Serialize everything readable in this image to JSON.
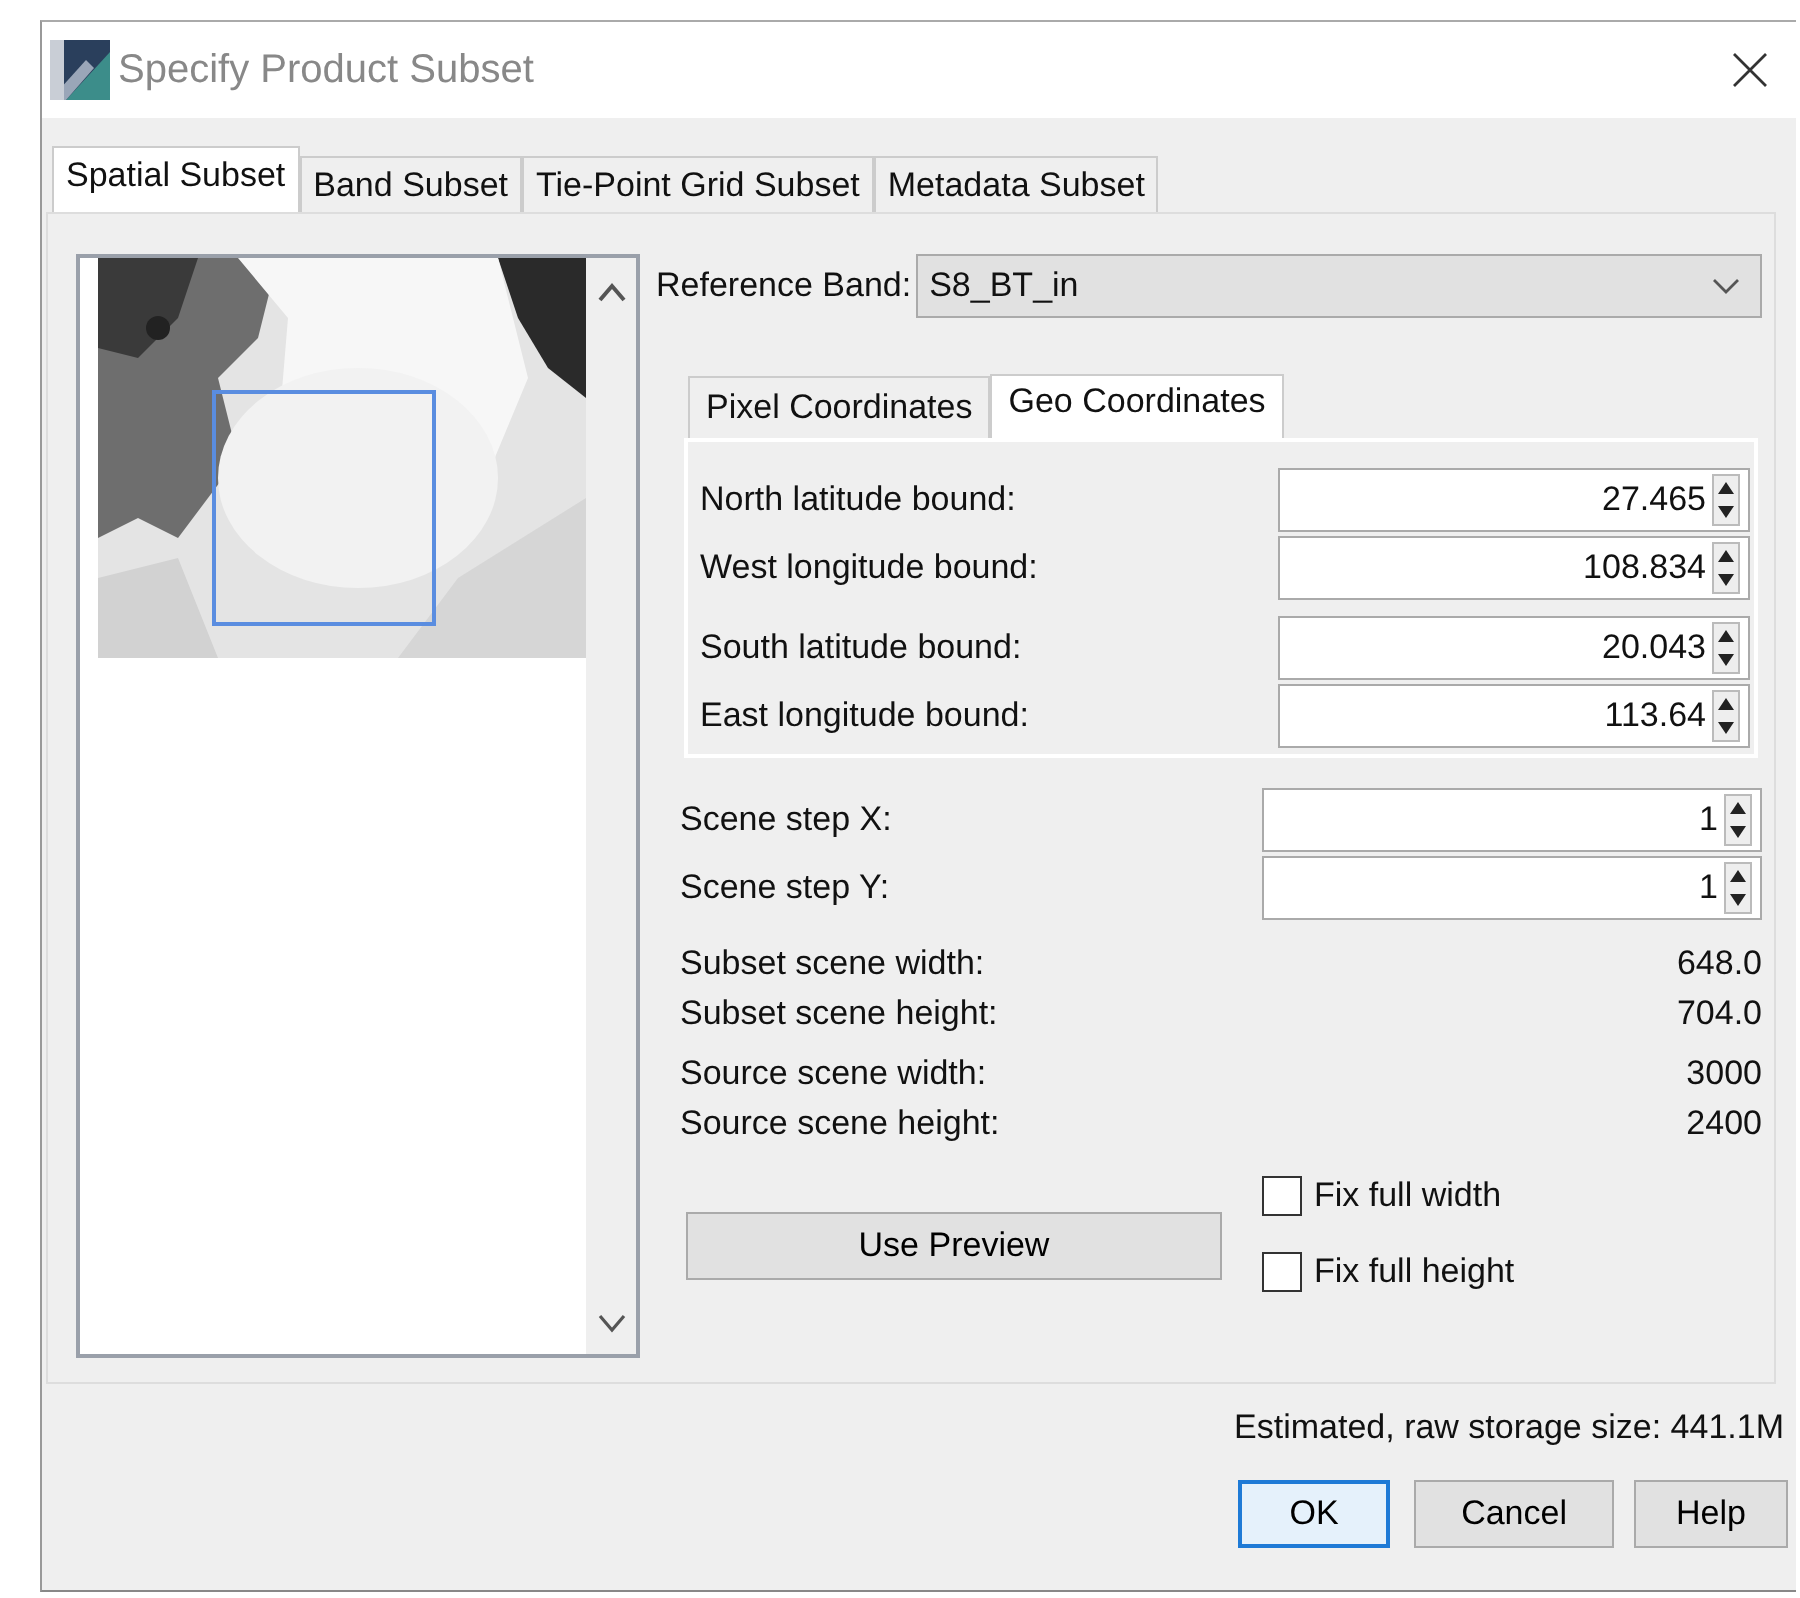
{
  "window": {
    "title": "Specify Product Subset"
  },
  "tabs": [
    {
      "label": "Spatial Subset",
      "selected": true
    },
    {
      "label": "Band Subset",
      "selected": false
    },
    {
      "label": "Tie-Point Grid Subset",
      "selected": false
    },
    {
      "label": "Metadata Subset",
      "selected": false
    }
  ],
  "reference_band": {
    "label": "Reference Band:",
    "value": "S8_BT_in"
  },
  "coordinate_tabs": [
    {
      "label": "Pixel Coordinates",
      "selected": false
    },
    {
      "label": "Geo Coordinates",
      "selected": true
    }
  ],
  "geo_fields": [
    {
      "label": "North latitude bound:",
      "value": "27.465"
    },
    {
      "label": "West longitude bound:",
      "value": "108.834"
    },
    {
      "label": "South latitude bound:",
      "value": "20.043"
    },
    {
      "label": "East longitude bound:",
      "value": "113.64"
    }
  ],
  "step_fields": [
    {
      "label": "Scene step X:",
      "value": "1"
    },
    {
      "label": "Scene step Y:",
      "value": "1"
    }
  ],
  "scene_info": [
    {
      "label": "Subset scene width:",
      "value": "648.0"
    },
    {
      "label": "Subset scene height:",
      "value": "704.0"
    },
    {
      "label": "Source scene width:",
      "value": "3000"
    },
    {
      "label": "Source scene height:",
      "value": "2400"
    }
  ],
  "use_preview_button": "Use Preview",
  "checkboxes": [
    {
      "label": "Fix full width",
      "checked": false
    },
    {
      "label": "Fix full height",
      "checked": false
    }
  ],
  "storage_size": "Estimated, raw storage size: 441.1M",
  "buttons": [
    {
      "label": "OK",
      "default": true
    },
    {
      "label": "Cancel",
      "default": false
    },
    {
      "label": "Help",
      "default": false
    }
  ]
}
